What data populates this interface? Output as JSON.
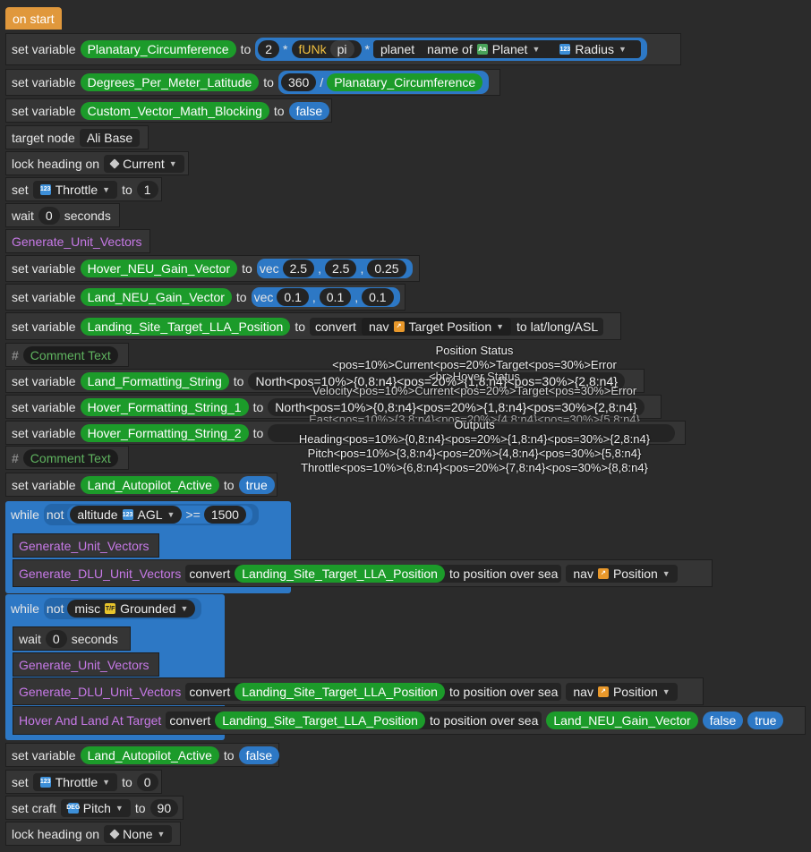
{
  "on_start": "on start",
  "kw": {
    "set_variable": "set variable",
    "to": "to",
    "target_node": "target node",
    "lock_heading_on": "lock heading on",
    "set": "set",
    "wait": "wait",
    "seconds": "seconds",
    "convert": "convert",
    "to_lat_long_asl": "to lat/long/ASL",
    "while": "while",
    "not": "not",
    "gte": ">=",
    "to_position_over_sea": "to position over sea",
    "set_craft": "set craft",
    "altitude": "altitude",
    "misc": "misc",
    "nav": "nav",
    "vec": "vec",
    "times": "*",
    "divide": "/",
    "comma": ",",
    "hash": "#",
    "planet": "planet",
    "name_of": "name of",
    "funk": "fUNk",
    "pi": "pi"
  },
  "vars": {
    "planatary_circumference": "Planatary_Circumference",
    "degrees_per_meter_latitude": "Degrees_Per_Meter_Latitude",
    "custom_vector_math_blocking": "Custom_Vector_Math_Blocking",
    "hover_neu_gain_vector": "Hover_NEU_Gain_Vector",
    "land_neu_gain_vector": "Land_NEU_Gain_Vector",
    "landing_site_target_lla_position": "Landing_Site_Target_LLA_Position",
    "land_formatting_string": "Land_Formatting_String",
    "hover_formatting_string_1": "Hover_Formatting_String_1",
    "hover_formatting_string_2": "Hover_Formatting_String_2",
    "land_autopilot_active": "Land_Autopilot_Active"
  },
  "values": {
    "two": "2",
    "three_sixty": "360",
    "false": "false",
    "true": "true",
    "ali_base": "Ali Base",
    "one": "1",
    "zero": "0",
    "hover_gain": [
      "2.5",
      "2.5",
      "0.25"
    ],
    "land_gain": [
      "0.1",
      "0.1",
      "0.1"
    ],
    "fifteen_hundred": "1500",
    "ninety": "90"
  },
  "dropdowns": {
    "planet": "Planet",
    "radius": "Radius",
    "current": "Current",
    "throttle": "Throttle",
    "target_position": "Target Position",
    "agl": "AGL",
    "position": "Position",
    "grounded": "Grounded",
    "pitch": "Pitch",
    "none": "None"
  },
  "procs": {
    "generate_unit_vectors": "Generate_Unit_Vectors",
    "generate_dlu_unit_vectors": "Generate_DLU_Unit_Vectors",
    "hover_and_land_at_target": "Hover And Land At Target"
  },
  "comments": {
    "comment_text": "Comment Text"
  },
  "strings": {
    "land_fmt_preview": "North<pos=10%>{0,8:n4}<pos=20%>{1,8:n4}<pos=30%>{2,8:n4}",
    "hover1_preview": "North<pos=10%>{0,8:n4}<pos=20%>{1,8:n4}<pos=30%>{2,8:n4}"
  },
  "overlay": {
    "position_status": "Position Status",
    "pos_header": "<pos=10%>Current<pos=20%>Target<pos=30%>Error",
    "br_hover_status": "<br>Hover Status",
    "velocity_header": "Velocity<pos=10%>Current<pos=20%>Target<pos=30%>Error",
    "east_partial": "East<pos=10%>{3,8:n4}<pos=20%>{4,8:n4}<pos=30%>{5,8:n4}",
    "outputs": "Outputs",
    "heading": "Heading<pos=10%>{0,8:n4}<pos=20%>{1,8:n4}<pos=30%>{2,8:n4}",
    "pitch": "Pitch<pos=10%>{3,8:n4}<pos=20%>{4,8:n4}<pos=30%>{5,8:n4}",
    "throttle": "Throttle<pos=10%>{6,8:n4}<pos=20%>{7,8:n4}<pos=30%>{8,8:n4}"
  },
  "icons": {
    "number": "123",
    "text": "Aa",
    "vector": "nav",
    "bool": "T/F",
    "degree": "DEG"
  },
  "colors": {
    "background": "#2b2b2b",
    "block": "#353535",
    "variable": "#1c9b2a",
    "operator": "#2d78c5",
    "event": "#e0983c",
    "procedure_text": "#c779e7"
  }
}
